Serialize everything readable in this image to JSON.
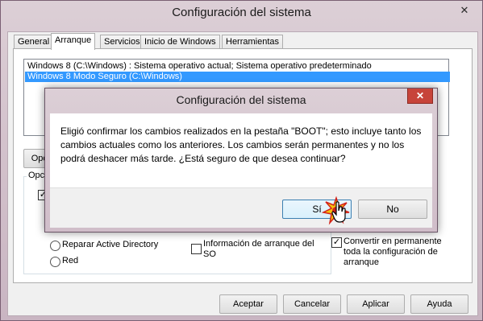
{
  "window": {
    "title": "Configuración del sistema",
    "close_glyph": "✕"
  },
  "tabs": [
    "General",
    "Arranque",
    "Servicios",
    "Inicio de Windows",
    "Herramientas"
  ],
  "os_list": [
    "Windows 8 (C:\\Windows) : Sistema operativo actual; Sistema operativo predeterminado",
    "Windows 8 Modo Seguro (C:\\Windows)"
  ],
  "panel": {
    "advanced_button_partial": "Opci",
    "options_group_partial": "Opc",
    "radio_repair": "Reparar Active Directory",
    "radio_red": "Red",
    "check_os_info": "Información de arranque del SO",
    "check_permanent": "Convertir en permanente toda la configuración de arranque"
  },
  "bottom_buttons": {
    "accept": "Aceptar",
    "cancel": "Cancelar",
    "apply": "Aplicar",
    "help": "Ayuda"
  },
  "dialog": {
    "title": "Configuración del sistema",
    "close_glyph": "✕",
    "message": "Eligió confirmar los cambios realizados en la pestaña \"BOOT\"; esto incluye tanto los cambios actuales como los anteriores. Los cambios serán permanentes y no los podrá deshacer más tarde. ¿Está seguro de que desea continuar?",
    "yes": "Sí",
    "no": "No"
  }
}
